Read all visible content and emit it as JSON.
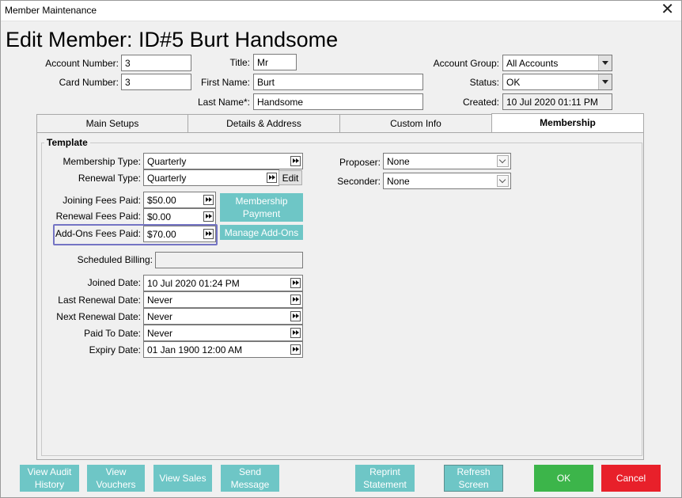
{
  "window": {
    "title": "Member Maintenance"
  },
  "heading": "Edit Member: ID#5 Burt Handsome",
  "fields": {
    "account_number": {
      "label": "Account Number:",
      "value": "3"
    },
    "card_number": {
      "label": "Card Number:",
      "value": "3"
    },
    "title": {
      "label": "Title:",
      "value": "Mr"
    },
    "first_name": {
      "label": "First Name:",
      "value": "Burt"
    },
    "last_name": {
      "label": "Last Name*:",
      "value": "Handsome"
    },
    "account_group": {
      "label": "Account Group:",
      "value": "All Accounts"
    },
    "status": {
      "label": "Status:",
      "value": "OK"
    },
    "created": {
      "label": "Created:",
      "value": "10 Jul 2020 01:11 PM"
    }
  },
  "tabs": [
    {
      "label": "Main Setups"
    },
    {
      "label": "Details & Address"
    },
    {
      "label": "Custom Info"
    },
    {
      "label": "Membership"
    }
  ],
  "template": {
    "group_label": "Template",
    "membership_type": {
      "label": "Membership Type:",
      "value": "Quarterly"
    },
    "renewal_type": {
      "label": "Renewal Type:",
      "value": "Quarterly",
      "edit_label": "Edit"
    },
    "joining_fees": {
      "label": "Joining Fees Paid:",
      "value": "$50.00"
    },
    "renewal_fees": {
      "label": "Renewal Fees Paid:",
      "value": "$0.00"
    },
    "addons_fees": {
      "label": "Add-Ons Fees Paid:",
      "value": "$70.00"
    },
    "membership_payment_label": "Membership\nPayment",
    "manage_addons_label": "Manage Add-Ons",
    "scheduled_billing": {
      "label": "Scheduled Billing:",
      "value": ""
    },
    "joined_date": {
      "label": "Joined Date:",
      "value": "10 Jul 2020 01:24 PM"
    },
    "last_renewal_date": {
      "label": "Last Renewal Date:",
      "value": "Never"
    },
    "next_renewal_date": {
      "label": "Next Renewal Date:",
      "value": "Never"
    },
    "paid_to_date": {
      "label": "Paid To Date:",
      "value": "Never"
    },
    "expiry_date": {
      "label": "Expiry Date:",
      "value": "01 Jan 1900 12:00 AM"
    },
    "proposer": {
      "label": "Proposer:",
      "value": "None"
    },
    "seconder": {
      "label": "Seconder:",
      "value": "None"
    }
  },
  "buttons": {
    "view_audit_history": "View Audit\nHistory",
    "view_vouchers": "View\nVouchers",
    "view_sales": "View Sales",
    "send_message": "Send\nMessage",
    "reprint_statement": "Reprint\nStatement",
    "refresh_screen": "Refresh\nScreen",
    "ok": "OK",
    "cancel": "Cancel"
  },
  "colors": {
    "teal_button": "#6ec6c6",
    "ok_green": "#3cb54a",
    "cancel_red": "#e8202a",
    "highlight": "#7474c4"
  }
}
